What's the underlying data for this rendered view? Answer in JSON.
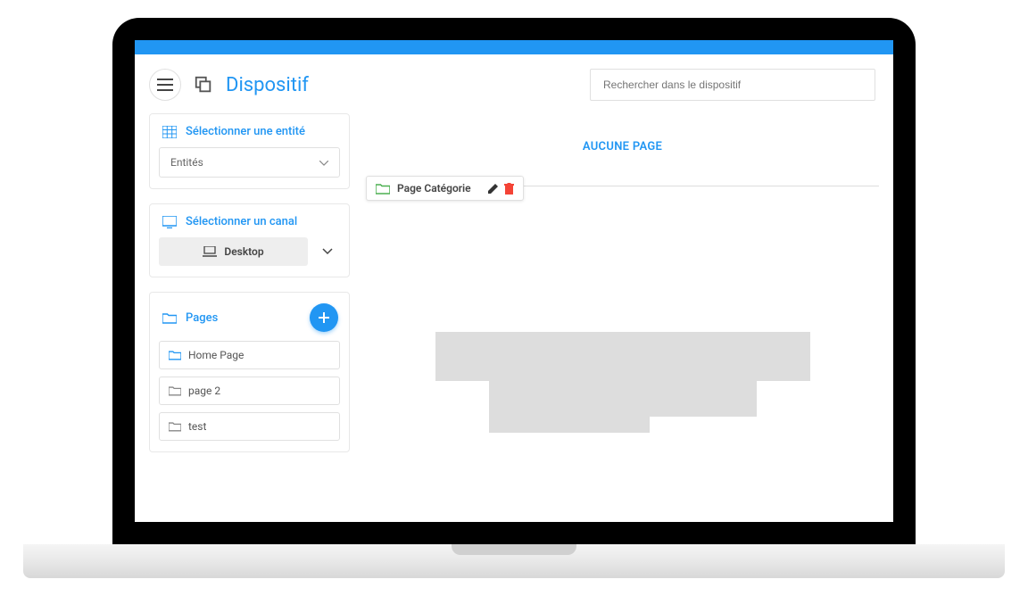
{
  "header": {
    "title": "Dispositif",
    "search_placeholder": "Rechercher dans le dispositif"
  },
  "panels": {
    "entity": {
      "title": "Sélectionner une entité",
      "select_placeholder": "Entités"
    },
    "channel": {
      "title": "Sélectionner un canal",
      "selected": "Desktop"
    },
    "pages": {
      "title": "Pages",
      "items": [
        {
          "label": "Home Page"
        },
        {
          "label": "page 2"
        },
        {
          "label": "test"
        }
      ]
    }
  },
  "main": {
    "empty_label": "AUCUNE PAGE",
    "category_chip": "Page Catégorie"
  }
}
